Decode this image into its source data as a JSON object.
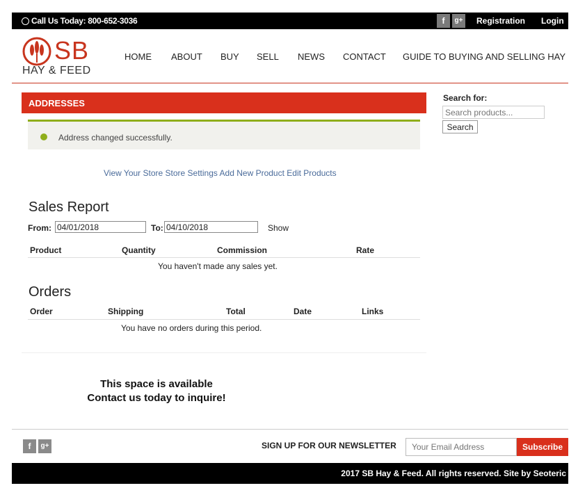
{
  "topbar": {
    "call": "Call Us Today: 800-652-3036",
    "facebook_glyph": "f",
    "google_glyph": "g+",
    "registration": "Registration",
    "login": "Login"
  },
  "logo": {
    "sb": "SB",
    "hay_feed": "HAY & FEED",
    "icon": "wheat-icon"
  },
  "nav": [
    "HOME",
    "ABOUT",
    "BUY",
    "SELL",
    "NEWS",
    "CONTACT",
    "GUIDE TO BUYING AND SELLING HAY"
  ],
  "addresses": {
    "title": "ADDRESSES"
  },
  "notice": {
    "icon": "check-circle-icon",
    "message": "Address changed successfully."
  },
  "store_links": "View Your Store Store Settings Add New Product Edit Products",
  "sales_report": {
    "title": "Sales Report",
    "from_label": "From:",
    "from_value": "04/01/2018",
    "to_label": "To:",
    "to_value": "04/10/2018",
    "show": "Show",
    "columns": [
      "Product",
      "Quantity",
      "Commission",
      "Rate"
    ],
    "empty": "You haven't made any sales yet."
  },
  "orders": {
    "title": "Orders",
    "columns": [
      "Order",
      "Shipping",
      "Total",
      "Date",
      "Links"
    ],
    "empty": "You have no orders during this period."
  },
  "ad": {
    "line1": "This space is available",
    "line2": "Contact us today to inquire!"
  },
  "sidebar": {
    "search_label": "Search for:",
    "placeholder": "Search products...",
    "button": "Search"
  },
  "newsletter": {
    "label": "SIGN UP FOR OUR NEWSLETTER",
    "placeholder": "Your Email Address",
    "button": "Subscribe"
  },
  "footer": {
    "copyright": "2017 SB Hay & Feed. All rights reserved. Site by Seoteric"
  },
  "colors": {
    "brand_red": "#d9301c",
    "success_green": "#8fae1b",
    "link_blue": "#4a6b9a"
  }
}
